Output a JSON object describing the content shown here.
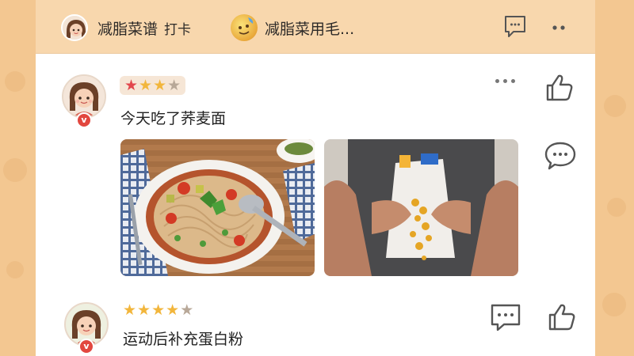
{
  "header": {
    "title": "减脂菜谱",
    "subtitle": "打卡",
    "title2": "减脂菜用毛..."
  },
  "posts": [
    {
      "text": "今天吃了荞麦面",
      "rating": 3,
      "rating_max": 5,
      "badge": "v",
      "images": [
        "buckwheat-noodle-bowl-photo",
        "person-holding-snack-bag-photo"
      ]
    },
    {
      "text": "运动后补充蛋白粉",
      "rating": 4,
      "rating_max": 5,
      "badge": "v"
    }
  ],
  "colors": {
    "background": "#f3c791",
    "header": "#f8d7ad",
    "card": "#ffffff",
    "star_red": "#e2474d",
    "star_gold": "#f2b63c",
    "star_empty": "#b8a898",
    "badge": "#e2473f",
    "icon": "#555555"
  }
}
